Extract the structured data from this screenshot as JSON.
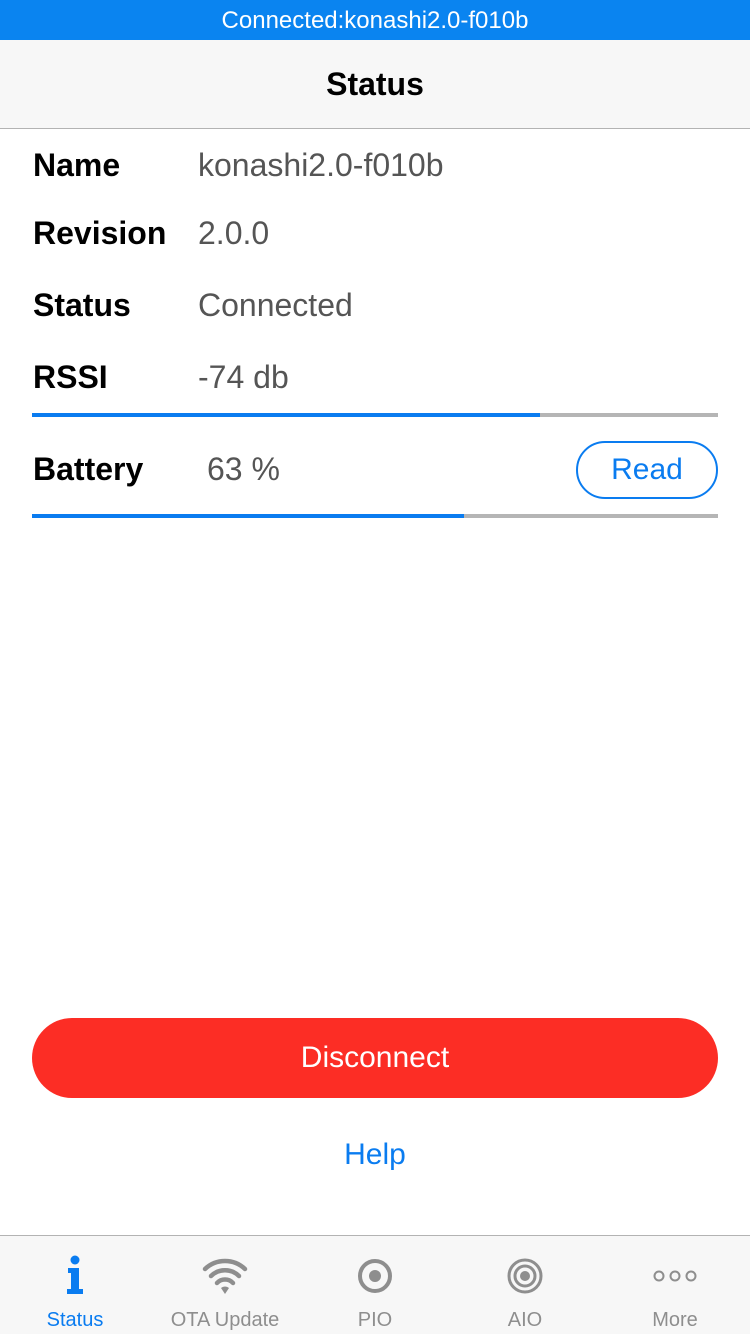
{
  "connection_banner": "Connected:konashi2.0-f010b",
  "nav": {
    "title": "Status"
  },
  "info": {
    "name": {
      "label": "Name",
      "value": "konashi2.0-f010b"
    },
    "revision": {
      "label": "Revision",
      "value": "2.0.0"
    },
    "status": {
      "label": "Status",
      "value": "Connected"
    },
    "rssi": {
      "label": "RSSI",
      "value": "-74 db",
      "level_fraction": 0.74
    },
    "battery": {
      "label": "Battery",
      "value": "63 %",
      "level_fraction": 0.63
    }
  },
  "buttons": {
    "read": "Read",
    "disconnect": "Disconnect",
    "help": "Help"
  },
  "tabs": [
    {
      "label": "Status",
      "icon": "info-icon",
      "active": true
    },
    {
      "label": "OTA Update",
      "icon": "wifi-icon",
      "active": false
    },
    {
      "label": "PIO",
      "icon": "target-icon",
      "active": false
    },
    {
      "label": "AIO",
      "icon": "rings-icon",
      "active": false
    },
    {
      "label": "More",
      "icon": "more-icon",
      "active": false
    }
  ],
  "colors": {
    "accent": "#0a7cf0",
    "banner": "#0a84f0",
    "destructive": "#fc2d25",
    "inactive_tab": "#8e8e8e"
  }
}
